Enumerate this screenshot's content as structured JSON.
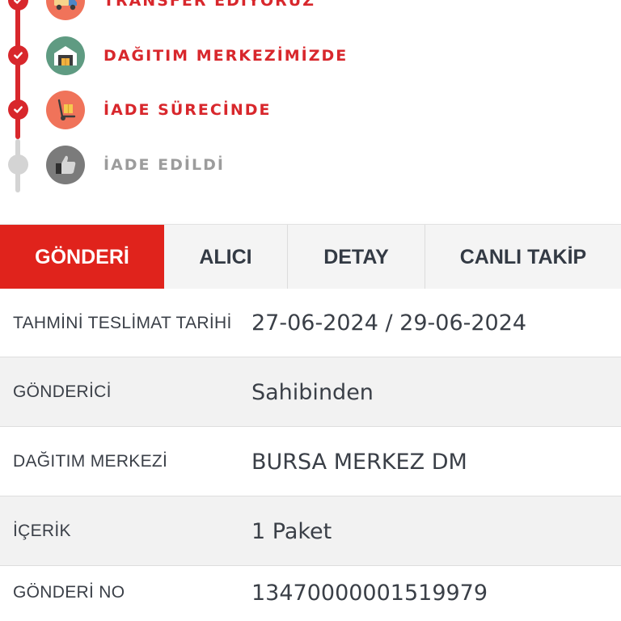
{
  "timeline": {
    "steps": [
      {
        "label": "TRANSFER EDİYORUZ",
        "status": "done",
        "icon": "truck-icon",
        "icon_bg": "#f0735a"
      },
      {
        "label": "DAĞITIM MERKEZİMİZDE",
        "status": "done",
        "icon": "warehouse-icon",
        "icon_bg": "#5f9b82"
      },
      {
        "label": "İADE SÜRECİNDE",
        "status": "done",
        "icon": "hand-truck-icon",
        "icon_bg": "#f0735a"
      },
      {
        "label": "İADE EDİLDİ",
        "status": "pending",
        "icon": "thumbs-up-icon",
        "icon_bg": "#7b7b7b"
      }
    ]
  },
  "tabs": [
    {
      "label": "GÖNDERİ",
      "active": true
    },
    {
      "label": "ALICI",
      "active": false
    },
    {
      "label": "DETAY",
      "active": false
    },
    {
      "label": "CANLI TAKİP",
      "active": false
    }
  ],
  "details": [
    {
      "label": "TAHMİNİ TESLİMAT TARİHİ",
      "value": "27-06-2024 / 29-06-2024"
    },
    {
      "label": "GÖNDERİCİ",
      "value": "Sahibinden"
    },
    {
      "label": "DAĞITIM MERKEZİ",
      "value": "BURSA MERKEZ DM"
    },
    {
      "label": "İÇERİK",
      "value": "1 Paket"
    },
    {
      "label": "GÖNDERİ NO",
      "value": "13470000001519979"
    }
  ],
  "colors": {
    "accent": "#d8272c",
    "tab_active": "#e0231c",
    "pending": "#d4d4d4",
    "text": "#3a3f47"
  }
}
